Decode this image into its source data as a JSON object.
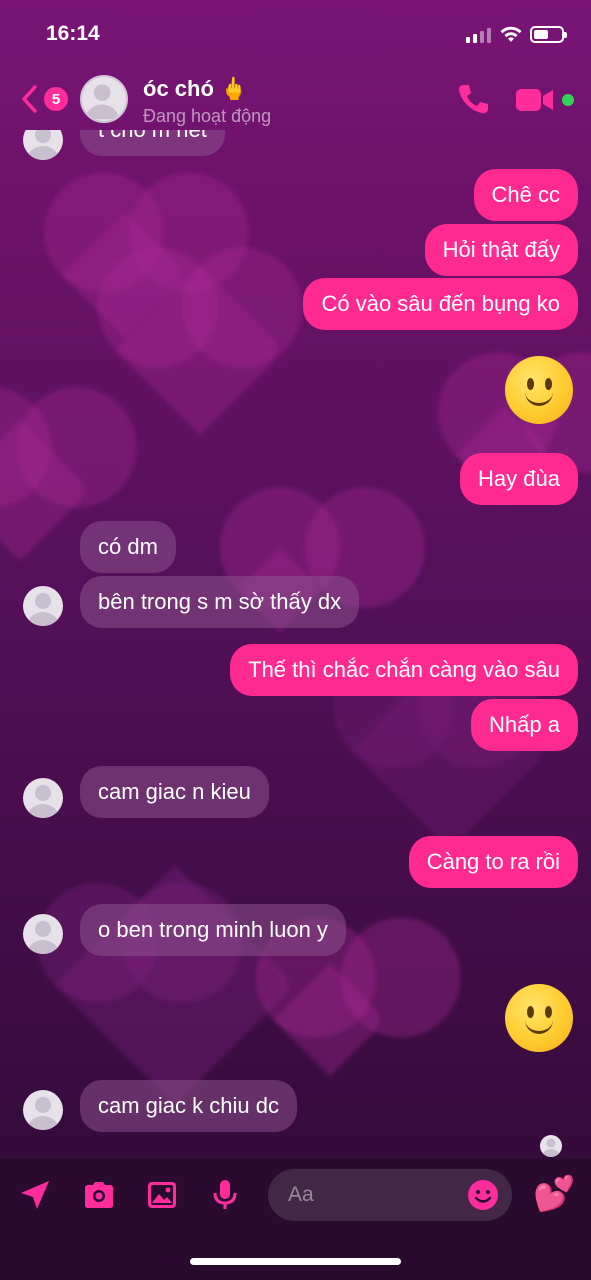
{
  "status_bar": {
    "time": "16:14"
  },
  "header": {
    "unread_count": "5",
    "contact_name": "óc chó 🖕",
    "presence": "Đang hoạt động"
  },
  "messages": [
    {
      "side": "in",
      "text": "t cho m hết"
    },
    {
      "side": "out",
      "text": "Chê cc"
    },
    {
      "side": "out",
      "text": "Hỏi thật đấy"
    },
    {
      "side": "out",
      "text": "Có vào sâu đến bụng ko"
    },
    {
      "side": "out",
      "type": "emoji",
      "text": "🙂"
    },
    {
      "side": "out",
      "text": "Hay đùa"
    },
    {
      "side": "in",
      "text": "có dm"
    },
    {
      "side": "in",
      "text": "bên trong s m sờ thấy dx"
    },
    {
      "side": "out",
      "text": "Thế thì chắc chắn càng vào sâu"
    },
    {
      "side": "out",
      "text": "Nhấp a"
    },
    {
      "side": "in",
      "text": "cam giac n kieu"
    },
    {
      "side": "out",
      "text": "Càng to ra rồi"
    },
    {
      "side": "in",
      "text": "o ben trong minh luon y"
    },
    {
      "side": "out",
      "type": "emoji",
      "text": "🙂"
    },
    {
      "side": "in",
      "text": "cam giac k chiu dc"
    }
  ],
  "composer": {
    "placeholder": "Aa",
    "like_emoji": "💕"
  },
  "colors": {
    "outgoing_bubble": "#ff2a90",
    "accent": "#ff2c9c",
    "online": "#31d158"
  },
  "icons": [
    "location-icon",
    "camera-icon",
    "gallery-icon",
    "microphone-icon",
    "emoji-icon",
    "phone-icon",
    "video-icon",
    "back-chevron-icon"
  ]
}
